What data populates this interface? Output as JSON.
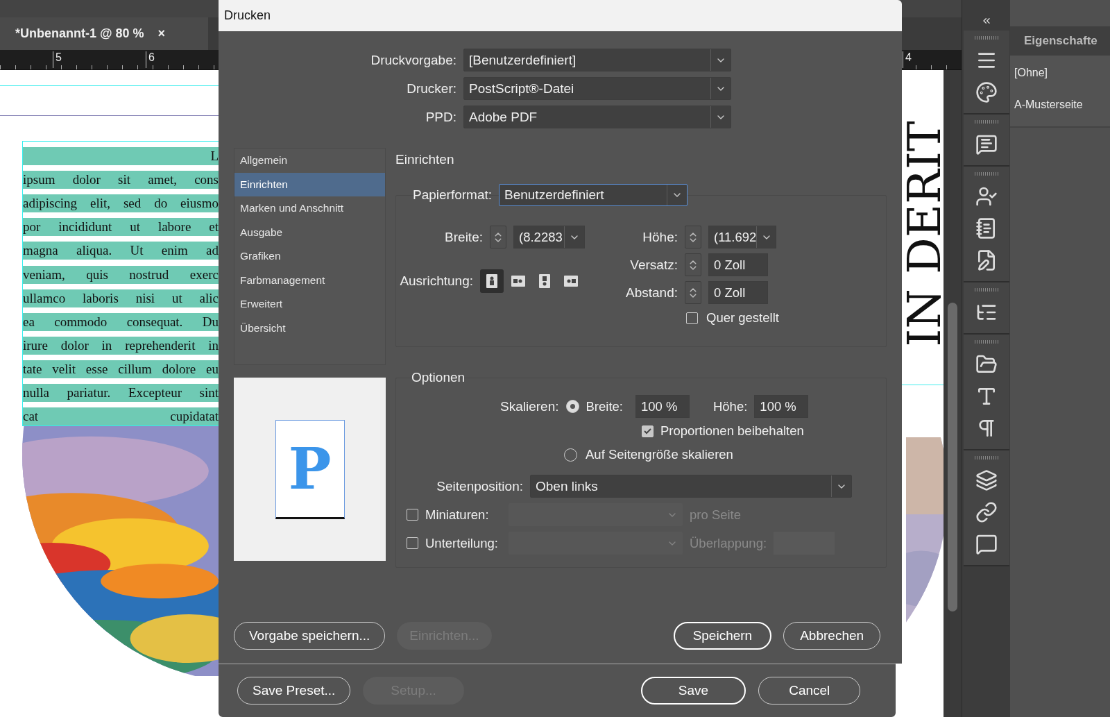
{
  "document_tab": {
    "title": "*Unbenannt-1 @ 80 %",
    "close": "×"
  },
  "ruler": {
    "labels": [
      "5",
      "6"
    ],
    "right_label": "4"
  },
  "page": {
    "first_line": "L",
    "lines": [
      "ipsum dolor sit amet, cons",
      "adipiscing elit, sed do eiusmo",
      "por incididunt ut labore et",
      "magna aliqua. Ut enim ad",
      "veniam, quis nostrud exerc",
      "ullamco laboris nisi ut alic",
      "ea commodo consequat. Du",
      "irure dolor in reprehenderit in",
      "tate velit esse cillum dolore eu",
      "nulla pariatur. Excepteur sint",
      "cat cupidatat"
    ],
    "vertical_heading": "IN DERIT"
  },
  "properties": {
    "tab": "Eigenschafte",
    "items": [
      "[Ohne]",
      "A-Musterseite"
    ]
  },
  "dialog": {
    "title": "Drucken",
    "presets": [
      {
        "label": "Druckvorgabe:",
        "value": "[Benutzerdefiniert]"
      },
      {
        "label": "Drucker:",
        "value": "PostScript®-Datei"
      },
      {
        "label": "PPD:",
        "value": "Adobe PDF"
      }
    ],
    "nav": [
      {
        "label": "Allgemein",
        "selected": false
      },
      {
        "label": "Einrichten",
        "selected": true
      },
      {
        "label": "Marken und Anschnitt",
        "selected": false
      },
      {
        "label": "Ausgabe",
        "selected": false
      },
      {
        "label": "Grafiken",
        "selected": false
      },
      {
        "label": "Farbmanagement",
        "selected": false
      },
      {
        "label": "Erweitert",
        "selected": false
      },
      {
        "label": "Übersicht",
        "selected": false
      }
    ],
    "preview": {
      "letter": "P"
    },
    "section_title": "Einrichten",
    "paper": {
      "label": "Papierformat:",
      "value": "Benutzerdefiniert",
      "focused": true
    },
    "width": {
      "label": "Breite:",
      "value": "(8.2283"
    },
    "height": {
      "label": "Höhe:",
      "value": "(11.692"
    },
    "offset": {
      "label": "Versatz:",
      "value": "0 Zoll"
    },
    "gap": {
      "label": "Abstand:",
      "value": "0 Zoll"
    },
    "orientation": {
      "label": "Ausrichtung:",
      "options": [
        {
          "kind": "portrait",
          "selected": true
        },
        {
          "kind": "landscape",
          "selected": false
        },
        {
          "kind": "portrait-flipped",
          "selected": false
        },
        {
          "kind": "landscape-flipped",
          "selected": false
        }
      ]
    },
    "transverse": {
      "label": "Quer gestellt",
      "checked": false
    },
    "options": {
      "title": "Optionen",
      "scale_label": "Skalieren:",
      "scale_width": {
        "label": "Breite:",
        "selected": true,
        "value": "100 %"
      },
      "scale_height": {
        "label": "Höhe:",
        "value": "100 %"
      },
      "proportions": {
        "label": "Proportionen beibehalten",
        "checked": true
      },
      "fit": {
        "label": "Auf Seitengröße skalieren",
        "selected": false
      },
      "position": {
        "label": "Seitenposition:",
        "value": "Oben links"
      },
      "thumbnails": {
        "label": "Miniaturen:",
        "checked": false,
        "disabled": true,
        "suffix": "pro Seite"
      },
      "tiling": {
        "label": "Unterteilung:",
        "checked": false,
        "disabled": true,
        "suffix": "Überlappung:"
      }
    },
    "buttons": [
      {
        "label": "Vorgabe speichern...",
        "disabled": false,
        "default": false
      },
      {
        "label": "Einrichten...",
        "disabled": true,
        "default": false
      },
      {
        "label": "Speichern",
        "disabled": false,
        "default": true
      },
      {
        "label": "Abbrechen",
        "disabled": false,
        "default": false
      }
    ]
  },
  "back_dialog": {
    "buttons": [
      {
        "label": "Save Preset...",
        "disabled": false,
        "default": false
      },
      {
        "label": "Setup...",
        "disabled": true,
        "default": false
      },
      {
        "label": "Save",
        "disabled": false,
        "default": true
      },
      {
        "label": "Cancel",
        "disabled": false,
        "default": false
      }
    ]
  }
}
